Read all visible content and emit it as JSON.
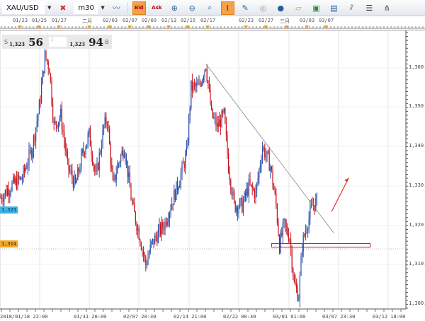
{
  "toolbar": {
    "symbol": "XAU/USD",
    "timeframe": "m30",
    "bid": "Bid",
    "ask": "Ask",
    "icons": [
      "remove-indicator-icon",
      "indicator-icon",
      "zoom-in-icon",
      "zoom-out-icon",
      "zoom-fit-icon",
      "cursor-icon",
      "edit-drawing-icon",
      "hide-drawing-icon",
      "globe-icon",
      "ruler-icon",
      "screenshot-icon",
      "template-icon",
      "fib-icon",
      "lines-icon",
      "pitchfork-icon"
    ]
  },
  "top_dates": [
    "01/23",
    "01/25",
    "01/27",
    "二月",
    "02/03",
    "02/07",
    "02/09",
    "02/13",
    "02/15",
    "02/17",
    "02/23",
    "02/27",
    "三月",
    "03/03",
    "03/07"
  ],
  "quote": {
    "sell_label": "S",
    "sell_prefix": "1,323",
    "sell_big": "56",
    "lot": "1",
    "buy_prefix": "1,323",
    "buy_big": "94",
    "buy_label": "B"
  },
  "bottom_dates": [
    "2018/01/18 22:00",
    "01/31 20:00",
    "02/07 20:30",
    "02/14 21:00",
    "02/22 00:30",
    "03/01 01:00",
    "03/07 23:30",
    "03/12 18:00"
  ],
  "price_axis": [
    "1,360.",
    "1,350.",
    "1,340.",
    "1,330.",
    "1,320.",
    "1,310.",
    "1,300."
  ],
  "current_price": "1,323.",
  "level_price": "1,314.",
  "colors": {
    "up": "#2a4fa8",
    "down": "#c8141e",
    "current": "#3fb4ea",
    "level": "#f5a623"
  },
  "chart_data": {
    "type": "candlestick",
    "ylim": [
      1298,
      1366
    ],
    "waypoints": [
      [
        0,
        1327
      ],
      [
        9,
        1330
      ],
      [
        19,
        1332
      ],
      [
        28,
        1340
      ],
      [
        34,
        1350
      ],
      [
        39,
        1363
      ],
      [
        43,
        1360
      ],
      [
        47,
        1345
      ],
      [
        53,
        1348
      ],
      [
        59,
        1335
      ],
      [
        66,
        1330
      ],
      [
        72,
        1338
      ],
      [
        78,
        1343
      ],
      [
        84,
        1332
      ],
      [
        91,
        1345
      ],
      [
        94,
        1347
      ],
      [
        99,
        1330
      ],
      [
        103,
        1335
      ],
      [
        109,
        1340
      ],
      [
        116,
        1325
      ],
      [
        122,
        1318
      ],
      [
        128,
        1310
      ],
      [
        133,
        1315
      ],
      [
        139,
        1318
      ],
      [
        144,
        1320
      ],
      [
        150,
        1325
      ],
      [
        156,
        1330
      ],
      [
        164,
        1338
      ],
      [
        168,
        1355
      ],
      [
        175,
        1355
      ],
      [
        181,
        1361
      ],
      [
        186,
        1348
      ],
      [
        191,
        1345
      ],
      [
        197,
        1348
      ],
      [
        201,
        1335
      ],
      [
        206,
        1325
      ],
      [
        213,
        1325
      ],
      [
        219,
        1330
      ],
      [
        225,
        1328
      ],
      [
        231,
        1340
      ],
      [
        238,
        1335
      ],
      [
        243,
        1325
      ],
      [
        246,
        1315
      ],
      [
        250,
        1320
      ],
      [
        255,
        1317
      ],
      [
        259,
        1305
      ],
      [
        263,
        1302
      ],
      [
        266,
        1315
      ],
      [
        270,
        1320
      ],
      [
        275,
        1325
      ],
      [
        279,
        1326
      ]
    ],
    "trendline": [
      [
        181,
        1361
      ],
      [
        294,
        1318
      ]
    ],
    "zone": {
      "from": 239,
      "to": 326,
      "low": 1314,
      "high": 1315
    },
    "level": 1314,
    "arrow": [
      [
        292,
        1319
      ],
      [
        307,
        1325
      ]
    ]
  }
}
